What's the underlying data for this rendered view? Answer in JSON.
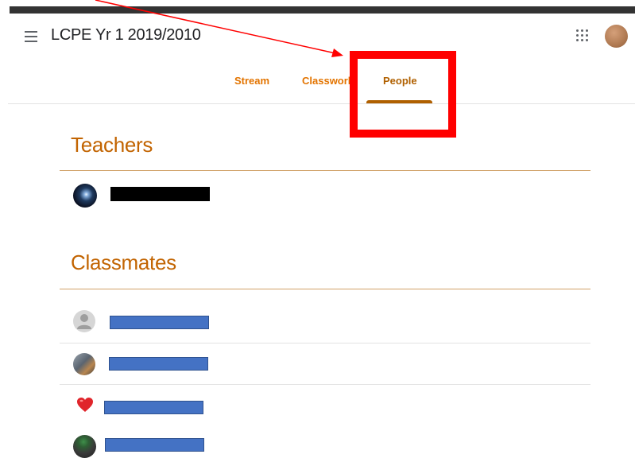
{
  "header": {
    "class_title": "LCPE Yr 1 2019/2010"
  },
  "tabs": [
    {
      "label": "Stream"
    },
    {
      "label": "Classwork"
    },
    {
      "label": "People",
      "selected": true
    }
  ],
  "sections": {
    "teachers": {
      "heading": "Teachers"
    },
    "classmates": {
      "heading": "Classmates"
    }
  },
  "icons": {
    "menu": "menu-icon",
    "apps": "apps-grid-icon",
    "account": "account-avatar",
    "default_avatar": "person-icon",
    "heart": "heart-icon"
  },
  "colors": {
    "accent": "#e37400",
    "heading": "#c26401",
    "tab_indicator": "#b06000",
    "annotation": "#ff0000",
    "redaction_blue": "#4472c4",
    "redaction_black": "#000000"
  }
}
